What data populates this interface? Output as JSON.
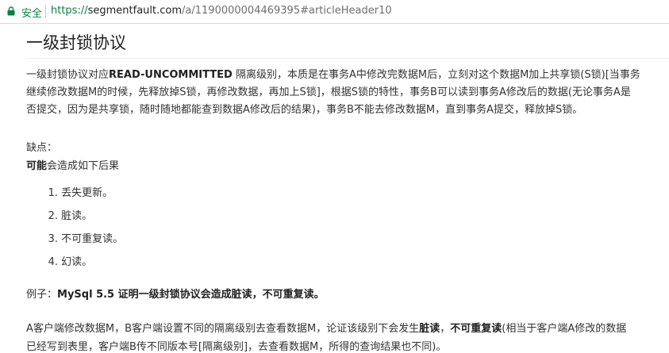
{
  "browser": {
    "secure_label": "安全",
    "url_scheme": "https://",
    "url_host": "segmentfault.com",
    "url_path": "/a/1190000004469395#articleHeader10"
  },
  "article": {
    "heading": "一级封锁协议",
    "paragraph_lines": [
      {
        "pre": "一级封锁协议对应",
        "bold": "READ-UNCOMMITTED",
        "post": " 隔离级别，本质是在事务A中修改完数据M后，立刻对这个数据M加上共享锁(S锁)[当事务"
      },
      {
        "pre": "继续修改数据M的时候，先释放掉S锁，再修改数据，再加上S锁]，根据S锁的特性，事务B可以读到事务A修改后的数据(无论事务A是",
        "bold": "",
        "post": ""
      },
      {
        "pre": "否提交，因为是共享锁，随时随地都能查到数据A修改后的结果)，事务B不能去修改数据M，直到事务A提交，释放掉S锁。",
        "bold": "",
        "post": ""
      }
    ],
    "drawback_label": "缺点：",
    "possible_bold": "可能",
    "possible_rest": "会造成如下后果",
    "list": [
      {
        "num": "1.",
        "text": "丢失更新。"
      },
      {
        "num": "2.",
        "text": "脏读。"
      },
      {
        "num": "3.",
        "text": "不可重复读。"
      },
      {
        "num": "4.",
        "text": "幻读。"
      }
    ],
    "example_label": "例子：",
    "example_bold": "MySql 5.5 证明一级封锁协议会造成脏读，不可重复读。",
    "last_line1_pre": "A客户端修改数据M，B客户端设置不同的隔离级别去查看数据M，论证该级别下会发生",
    "last_line1_bold1": "脏读",
    "last_line1_mid": "，",
    "last_line1_bold2": "不可重复读",
    "last_line1_post": "(相当于客户端A修改的数据",
    "last_line2": "已经写到表里，客户端B传不同版本号[隔离级别]，去查看数据M，所得的查询结果也不同)。"
  },
  "colors": {
    "secure_green": "#0b8043",
    "text": "#333333"
  }
}
